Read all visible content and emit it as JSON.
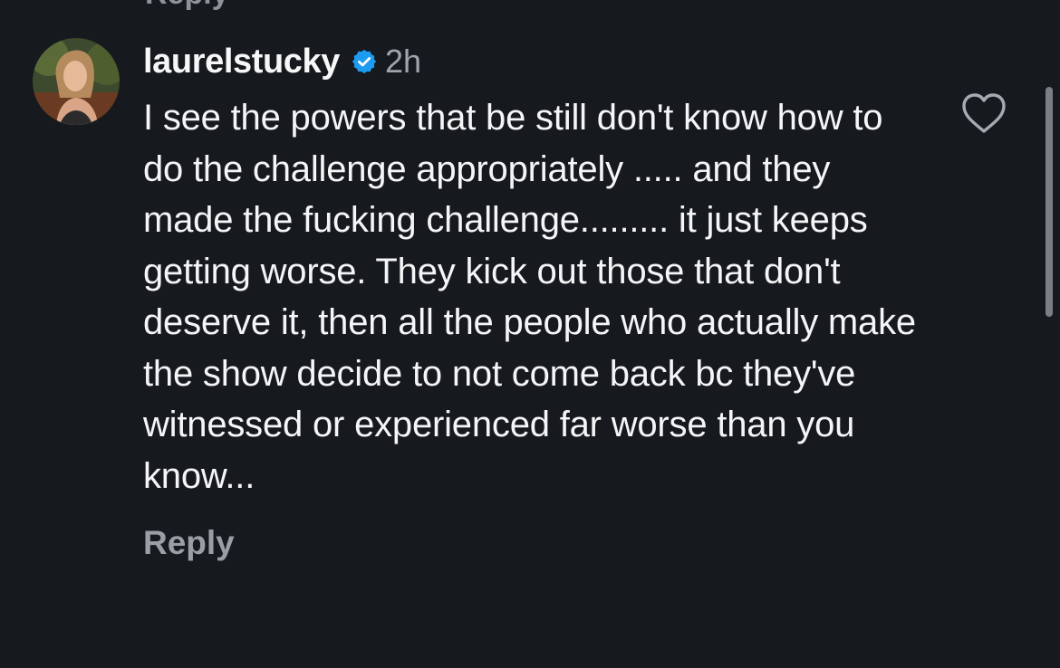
{
  "top_partial": {
    "label": "Reply"
  },
  "comment": {
    "username": "laurelstucky",
    "verified_icon": "verified-badge-icon",
    "timestamp": "2h",
    "text": "I see the powers that be still don't know how to do the challenge appropriately ..... and they made the fucking challenge......... it just keeps getting worse. They kick out those that don't deserve it, then all the people who actually make the show decide to not come back bc they've witnessed or experienced far worse than you know...",
    "reply_label": "Reply",
    "like_icon": "heart-outline-icon",
    "avatar_icon": "profile-photo"
  },
  "colors": {
    "background": "#16191d",
    "primary_text": "#f4f5f7",
    "secondary_text": "#a1a5ab",
    "verified_blue": "#1d9bf0"
  }
}
